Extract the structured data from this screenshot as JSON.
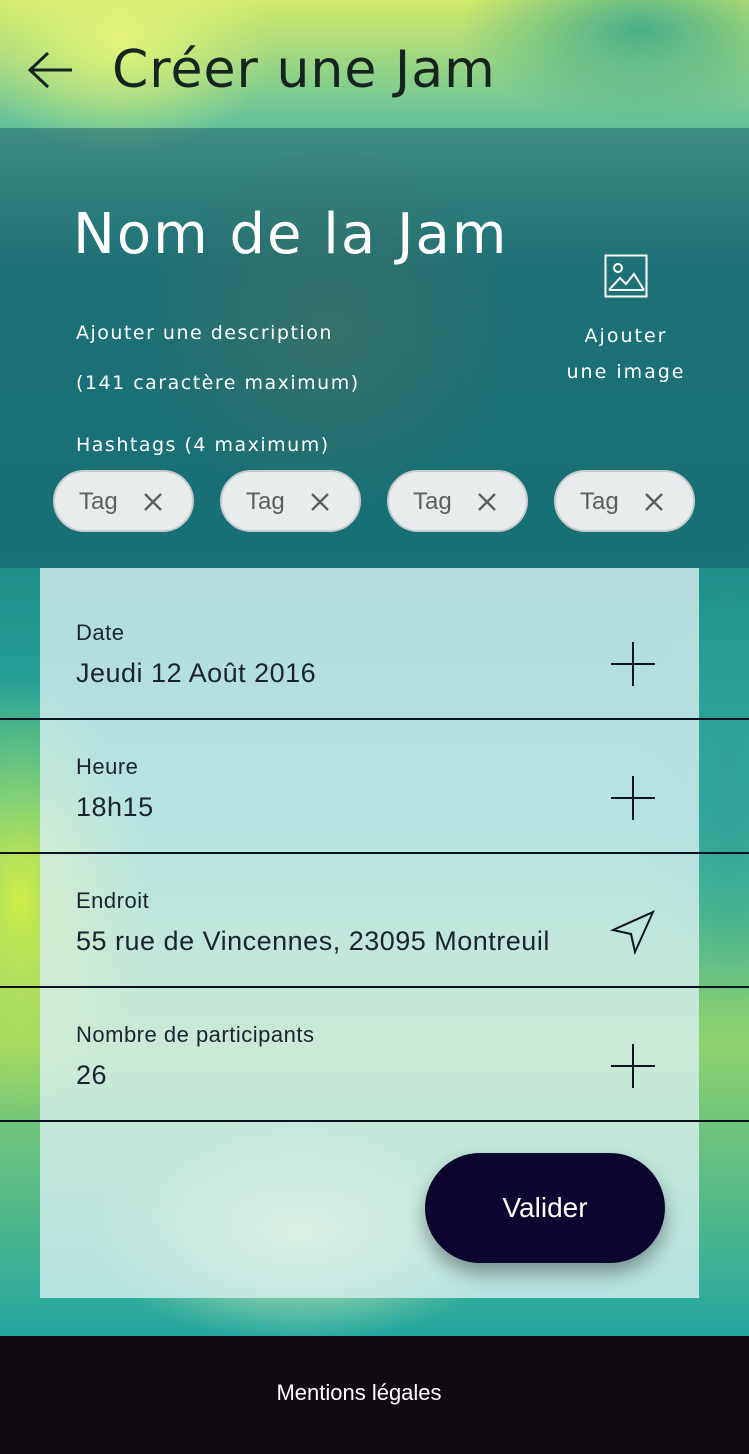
{
  "header": {
    "title": "Créer une Jam",
    "back_icon": "arrow-left-icon"
  },
  "hero": {
    "jam_name": "Nom de la Jam",
    "description_placeholder": "Ajouter une description",
    "description_limit": "(141 caractère maximum)",
    "hashtags_label": "Hashtags (4 maximum)",
    "add_image_line1": "Ajouter",
    "add_image_line2": "une image",
    "add_image_icon": "image-icon",
    "tags": [
      {
        "label": "Tag"
      },
      {
        "label": "Tag"
      },
      {
        "label": "Tag"
      },
      {
        "label": "Tag"
      }
    ]
  },
  "form": {
    "fields": [
      {
        "label": "Date",
        "value": "Jeudi 12 Août 2016",
        "icon": "plus-icon"
      },
      {
        "label": "Heure",
        "value": "18h15",
        "icon": "plus-icon"
      },
      {
        "label": "Endroit",
        "value": "55 rue de Vincennes, 23095 Montreuil",
        "icon": "location-arrow-icon"
      },
      {
        "label": "Nombre de participants",
        "value": "26",
        "icon": "plus-icon"
      }
    ],
    "submit_label": "Valider"
  },
  "footer": {
    "legal_label": "Mentions légales"
  },
  "colors": {
    "button": "#0c0530",
    "footer": "#120a12",
    "text_dark": "#1a2430"
  }
}
